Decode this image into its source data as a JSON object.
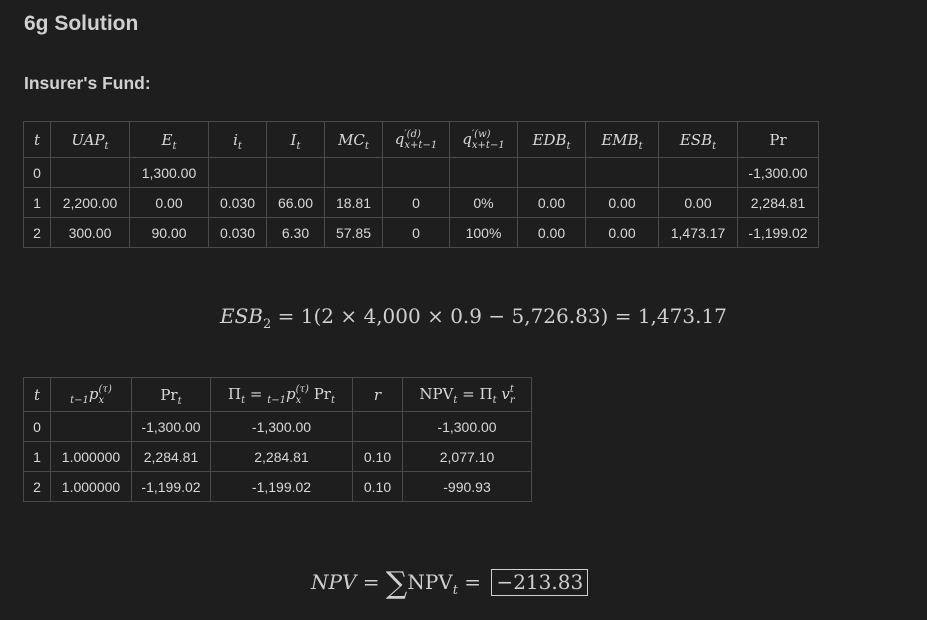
{
  "title": "6g Solution",
  "section_title": "Insurer's Fund:",
  "fund_table": {
    "rows": [
      {
        "t": "0",
        "UAP": "",
        "E": "1,300.00",
        "i": "",
        "I": "",
        "MC": "",
        "qd": "",
        "qw": "",
        "EDB": "",
        "EMB": "",
        "ESB": "",
        "Pr": "-1,300.00"
      },
      {
        "t": "1",
        "UAP": "2,200.00",
        "E": "0.00",
        "i": "0.030",
        "I": "66.00",
        "MC": "18.81",
        "qd": "0",
        "qw": "0%",
        "EDB": "0.00",
        "EMB": "0.00",
        "ESB": "0.00",
        "Pr": "2,284.81"
      },
      {
        "t": "2",
        "UAP": "300.00",
        "E": "90.00",
        "i": "0.030",
        "I": "6.30",
        "MC": "57.85",
        "qd": "0",
        "qw": "100%",
        "EDB": "0.00",
        "EMB": "0.00",
        "ESB": "1,473.17",
        "Pr": "-1,199.02"
      }
    ]
  },
  "esb_equation": {
    "lhs": "ESB",
    "lhs_sub": "2",
    "rhs": " = 1(2 × 4,000 × 0.9 − 5,726.83) = 1,473.17"
  },
  "npv_table": {
    "rows": [
      {
        "t": "0",
        "p": "",
        "Pr": "-1,300.00",
        "Pi": "-1,300.00",
        "r": "",
        "NPV": "-1,300.00"
      },
      {
        "t": "1",
        "p": "1.000000",
        "Pr": "2,284.81",
        "Pi": "2,284.81",
        "r": "0.10",
        "NPV": "2,077.10"
      },
      {
        "t": "2",
        "p": "1.000000",
        "Pr": "-1,199.02",
        "Pi": "-1,199.02",
        "r": "0.10",
        "NPV": "-990.93"
      }
    ]
  },
  "npv_equation": {
    "lhs": "NPV",
    "result": "−213.83"
  }
}
